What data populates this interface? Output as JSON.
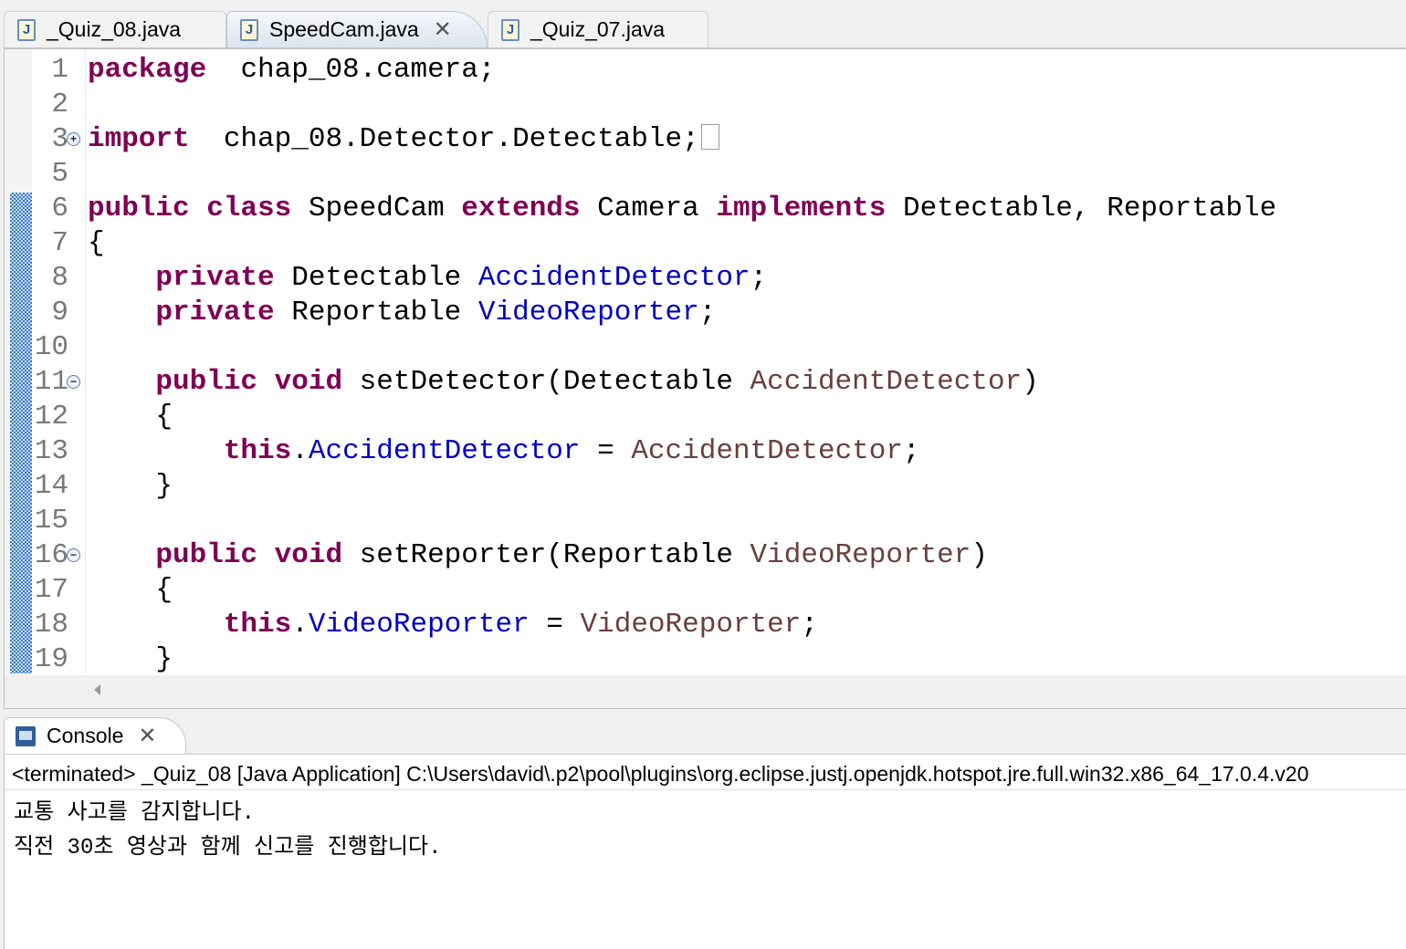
{
  "editor_tabs": [
    {
      "label": "_Quiz_08.java",
      "icon": "java-file-icon",
      "active": false
    },
    {
      "label": "SpeedCam.java",
      "icon": "java-file-icon",
      "active": true
    },
    {
      "label": "_Quiz_07.java",
      "icon": "java-file-icon",
      "active": false
    }
  ],
  "colors": {
    "keyword": "#7f0055",
    "field": "#0000c0",
    "parameter": "#6a3e3e",
    "change_marker": "#3a78c8"
  },
  "code_lines": [
    {
      "n": "1",
      "tokens": [
        [
          "kw",
          "package"
        ],
        [
          "",
          "  chap_08.camera;"
        ]
      ]
    },
    {
      "n": "2",
      "tokens": []
    },
    {
      "n": "3",
      "fold": "+",
      "tokens": [
        [
          "kw",
          "import"
        ],
        [
          "",
          "  chap_08.Detector.Detectable;"
        ]
      ]
    },
    {
      "n": "5",
      "tokens": []
    },
    {
      "n": "6",
      "tokens": [
        [
          "kw",
          "public class"
        ],
        [
          "",
          " SpeedCam "
        ],
        [
          "kw",
          "extends"
        ],
        [
          "",
          " Camera "
        ],
        [
          "kw",
          "implements"
        ],
        [
          "",
          " Detectable, Reportable"
        ]
      ]
    },
    {
      "n": "7",
      "tokens": [
        [
          "",
          "{"
        ]
      ]
    },
    {
      "n": "8",
      "tokens": [
        [
          "",
          "    "
        ],
        [
          "kw",
          "private"
        ],
        [
          "",
          " Detectable "
        ],
        [
          "fld",
          "AccidentDetector"
        ],
        [
          "",
          ";"
        ]
      ]
    },
    {
      "n": "9",
      "tokens": [
        [
          "",
          "    "
        ],
        [
          "kw",
          "private"
        ],
        [
          "",
          " Reportable "
        ],
        [
          "fld",
          "VideoReporter"
        ],
        [
          "",
          ";"
        ]
      ]
    },
    {
      "n": "10",
      "tokens": []
    },
    {
      "n": "11",
      "fold": "-",
      "tokens": [
        [
          "",
          "    "
        ],
        [
          "kw",
          "public void"
        ],
        [
          "",
          " setDetector(Detectable "
        ],
        [
          "par",
          "AccidentDetector"
        ],
        [
          "",
          ")"
        ]
      ]
    },
    {
      "n": "12",
      "tokens": [
        [
          "",
          "    {"
        ]
      ]
    },
    {
      "n": "13",
      "tokens": [
        [
          "",
          "        "
        ],
        [
          "kw",
          "this"
        ],
        [
          "",
          "."
        ],
        [
          "fld",
          "AccidentDetector"
        ],
        [
          "",
          " = "
        ],
        [
          "par",
          "AccidentDetector"
        ],
        [
          "",
          ";"
        ]
      ]
    },
    {
      "n": "14",
      "tokens": [
        [
          "",
          "    }"
        ]
      ]
    },
    {
      "n": "15",
      "tokens": []
    },
    {
      "n": "16",
      "fold": "-",
      "tokens": [
        [
          "",
          "    "
        ],
        [
          "kw",
          "public void"
        ],
        [
          "",
          " setReporter(Reportable "
        ],
        [
          "par",
          "VideoReporter"
        ],
        [
          "",
          ")"
        ]
      ]
    },
    {
      "n": "17",
      "tokens": [
        [
          "",
          "    {"
        ]
      ]
    },
    {
      "n": "18",
      "tokens": [
        [
          "",
          "        "
        ],
        [
          "kw",
          "this"
        ],
        [
          "",
          "."
        ],
        [
          "fld",
          "VideoReporter"
        ],
        [
          "",
          " = "
        ],
        [
          "par",
          "VideoReporter"
        ],
        [
          "",
          ";"
        ]
      ]
    },
    {
      "n": "19",
      "tokens": [
        [
          "",
          "    }"
        ]
      ]
    }
  ],
  "console": {
    "tab_label": "Console",
    "status": "<terminated> _Quiz_08 [Java Application] C:\\Users\\david\\.p2\\pool\\plugins\\org.eclipse.justj.openjdk.hotspot.jre.full.win32.x86_64_17.0.4.v20",
    "output": [
      "교통 사고를 감지합니다.",
      "직전 30초 영상과 함께 신고를 진행합니다."
    ]
  }
}
